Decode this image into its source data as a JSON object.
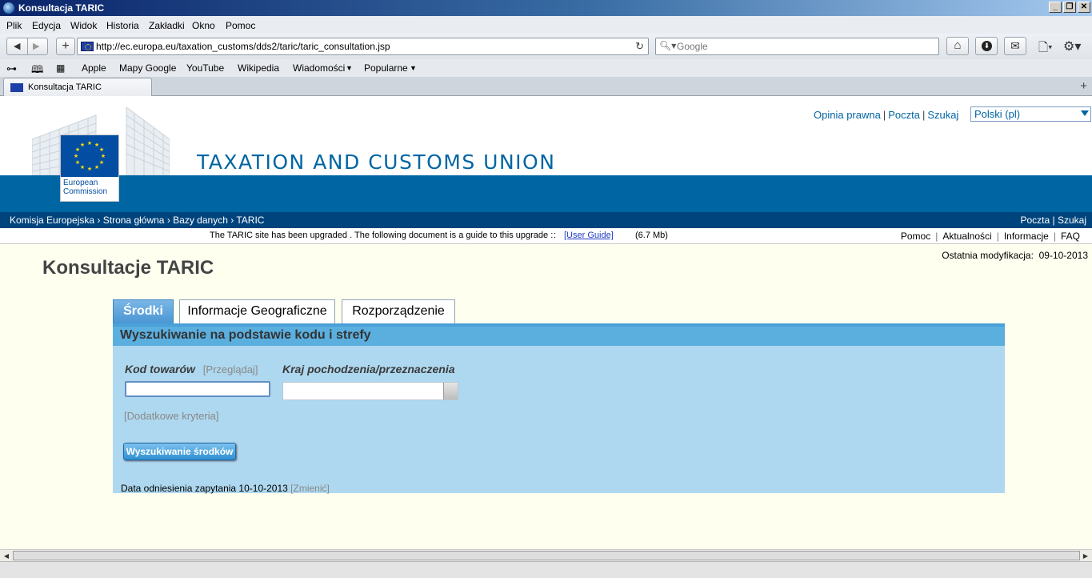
{
  "window": {
    "title": "Konsultacja TARIC"
  },
  "menu": [
    "Plik",
    "Edycja",
    "Widok",
    "Historia",
    "Zakładki",
    "Okno",
    "Pomoc"
  ],
  "nav": {
    "url": "http://ec.europa.eu/taxation_customs/dds2/taric/taric_consultation.jsp",
    "search_placeholder": "Google"
  },
  "bookmarks": [
    "Apple",
    "Mapy Google",
    "YouTube",
    "Wikipedia",
    "Wiadomości",
    "Popularne"
  ],
  "tab": {
    "label": "Konsultacja TARIC"
  },
  "header": {
    "site_title": "TAXATION AND CUSTOMS UNION",
    "logo_line1": "European",
    "logo_line2": "Commission",
    "toplinks": [
      "Opinia prawna",
      "Poczta",
      "Szukaj"
    ],
    "language": "Polski (pl)"
  },
  "breadcrumb": {
    "items": [
      "Komisja Europejska",
      "Strona główna",
      "Bazy danych",
      "TARIC"
    ],
    "right": "Poczta | Szukaj"
  },
  "infobar": {
    "message": "The TARIC site has been upgraded . The following document is a guide to this upgrade :",
    "sep": ":",
    "user_guide": "[User Guide]",
    "size": "(6.7 Mb)",
    "links": [
      "Pomoc",
      "Aktualności",
      "Informacje",
      "FAQ"
    ]
  },
  "main": {
    "title": "Konsultacje TARIC",
    "last_modified_label": "Ostatnia modyfikacja:",
    "last_modified_value": "09-10-2013",
    "tabs": [
      "Środki",
      "Informacje Geograficzne",
      "Rozporządzenie"
    ],
    "panel_header": "Wyszukiwanie na podstawie kodu i strefy",
    "kod_label": "Kod towarów",
    "kod_browse": "[Przeglądaj]",
    "kraj_label": "Kraj pochodzenia/przeznaczenia",
    "extra_criteria": "[Dodatkowe kryteria]",
    "search_button": "Wyszukiwanie środków",
    "ref_date_label": "Data odniesienia zapytania 10-10-2013",
    "ref_date_change": "[Zmienić]"
  }
}
